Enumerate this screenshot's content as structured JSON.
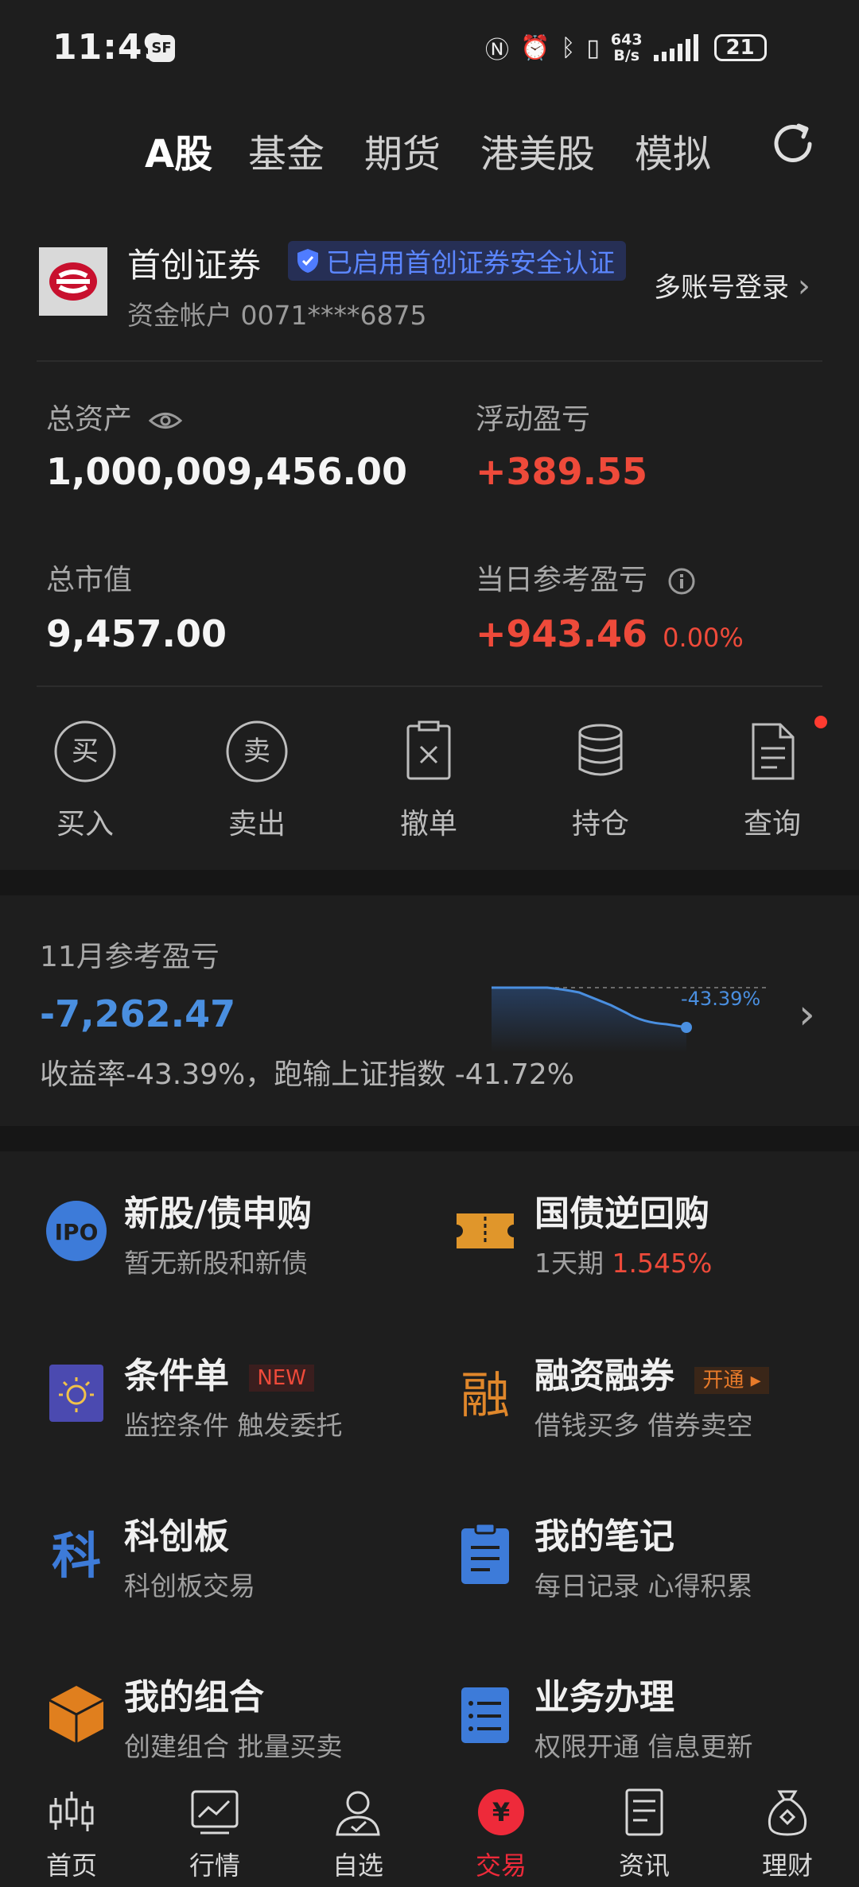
{
  "status": {
    "time": "11:49",
    "sf": "SF",
    "net_speed_top": "643",
    "net_speed_bottom": "B/s",
    "battery": "21"
  },
  "tabs": [
    "A股",
    "基金",
    "期货",
    "港美股",
    "模拟"
  ],
  "broker": {
    "name": "首创证券",
    "security_badge": "已启用首创证券安全认证",
    "account": "资金帐户 0071****6875",
    "multi_login": "多账号登录"
  },
  "assets": {
    "total_label": "总资产",
    "total_value": "1,000,009,456.00",
    "floating_label": "浮动盈亏",
    "floating_value": "+389.55",
    "market_label": "总市值",
    "market_value": "9,457.00",
    "daily_label": "当日参考盈亏",
    "daily_value": "+943.46",
    "daily_pct": "0.00%"
  },
  "actions": [
    {
      "label": "买入",
      "icon": "buy-icon",
      "glyph": "买"
    },
    {
      "label": "卖出",
      "icon": "sell-icon",
      "glyph": "卖"
    },
    {
      "label": "撤单",
      "icon": "cancel-order-icon"
    },
    {
      "label": "持仓",
      "icon": "holdings-icon"
    },
    {
      "label": "查询",
      "icon": "query-icon"
    }
  ],
  "monthly": {
    "title": "11月参考盈亏",
    "value": "-7,262.47",
    "spark_label": "-43.39%",
    "desc": "收益率-43.39%，跑输上证指数 -41.72%"
  },
  "grid": [
    {
      "title": "新股/债申购",
      "sub": "暂无新股和新债",
      "icon": "ipo-icon",
      "icon_text": "IPO"
    },
    {
      "title": "国债逆回购",
      "sub_prefix": "1天期",
      "sub_value": "1.545%",
      "icon": "ticket-icon"
    },
    {
      "title": "条件单",
      "tag": "NEW",
      "sub": "监控条件 触发委托",
      "icon": "condition-order-icon"
    },
    {
      "title": "融资融券",
      "tag": "开通",
      "sub": "借钱买多 借券卖空",
      "icon": "margin-icon",
      "icon_text": "融"
    },
    {
      "title": "科创板",
      "sub": "科创板交易",
      "icon": "star-market-icon",
      "icon_text": "科"
    },
    {
      "title": "我的笔记",
      "sub": "每日记录 心得积累",
      "icon": "notes-icon"
    },
    {
      "title": "我的组合",
      "sub": "创建组合 批量买卖",
      "icon": "portfolio-icon"
    },
    {
      "title": "业务办理",
      "sub": "权限开通 信息更新",
      "icon": "business-icon"
    }
  ],
  "nav": [
    {
      "label": "首页",
      "icon": "home-chart-icon"
    },
    {
      "label": "行情",
      "icon": "market-icon"
    },
    {
      "label": "自选",
      "icon": "watchlist-icon"
    },
    {
      "label": "交易",
      "icon": "trade-icon",
      "glyph": "¥"
    },
    {
      "label": "资讯",
      "icon": "news-icon"
    },
    {
      "label": "理财",
      "icon": "wealth-icon"
    }
  ]
}
